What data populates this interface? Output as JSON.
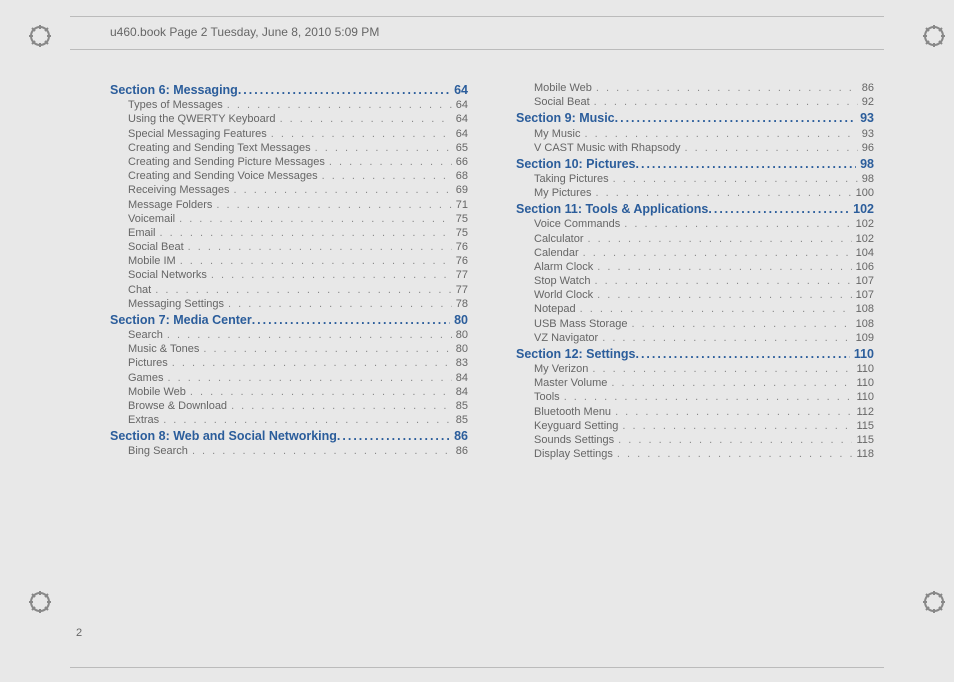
{
  "header_text": "u460.book  Page 2  Tuesday, June 8, 2010  5:09 PM",
  "page_number": "2",
  "columns": [
    [
      {
        "type": "section",
        "label": "Section 6:   Messaging",
        "page": "64"
      },
      {
        "type": "entry",
        "label": "Types of Messages",
        "page": "64"
      },
      {
        "type": "entry",
        "label": "Using the QWERTY Keyboard",
        "page": "64"
      },
      {
        "type": "entry",
        "label": "Special Messaging Features",
        "page": "64"
      },
      {
        "type": "entry",
        "label": "Creating and Sending Text Messages",
        "page": "65"
      },
      {
        "type": "entry",
        "label": "Creating and Sending Picture Messages",
        "page": "66"
      },
      {
        "type": "entry",
        "label": "Creating and Sending Voice Messages",
        "page": "68"
      },
      {
        "type": "entry",
        "label": "Receiving Messages",
        "page": "69"
      },
      {
        "type": "entry",
        "label": "Message Folders",
        "page": "71"
      },
      {
        "type": "entry",
        "label": "Voicemail",
        "page": "75"
      },
      {
        "type": "entry",
        "label": "Email",
        "page": "75"
      },
      {
        "type": "entry",
        "label": "Social Beat",
        "page": "76"
      },
      {
        "type": "entry",
        "label": "Mobile IM",
        "page": "76"
      },
      {
        "type": "entry",
        "label": "Social Networks",
        "page": "77"
      },
      {
        "type": "entry",
        "label": "Chat",
        "page": "77"
      },
      {
        "type": "entry",
        "label": "Messaging Settings",
        "page": "78"
      },
      {
        "type": "section",
        "label": "Section 7:  Media Center",
        "page": "80"
      },
      {
        "type": "entry",
        "label": "Search",
        "page": "80"
      },
      {
        "type": "entry",
        "label": "Music & Tones",
        "page": "80"
      },
      {
        "type": "entry",
        "label": "Pictures",
        "page": "83"
      },
      {
        "type": "entry",
        "label": "Games",
        "page": "84"
      },
      {
        "type": "entry",
        "label": "Mobile Web",
        "page": "84"
      },
      {
        "type": "entry",
        "label": "Browse & Download",
        "page": "85"
      },
      {
        "type": "entry",
        "label": "Extras",
        "page": "85"
      },
      {
        "type": "section",
        "label": "Section 8:  Web and Social Networking",
        "page": "86"
      },
      {
        "type": "entry",
        "label": "Bing Search",
        "page": "86"
      }
    ],
    [
      {
        "type": "entry",
        "label": "Mobile Web",
        "page": "86"
      },
      {
        "type": "entry",
        "label": "Social Beat",
        "page": "92"
      },
      {
        "type": "section",
        "label": "Section 9:  Music",
        "page": "93"
      },
      {
        "type": "entry",
        "label": "My Music",
        "page": "93"
      },
      {
        "type": "entry",
        "label": "V CAST Music with Rhapsody",
        "page": "96"
      },
      {
        "type": "section",
        "label": "Section 10:  Pictures",
        "page": "98"
      },
      {
        "type": "entry",
        "label": "Taking Pictures",
        "page": "98"
      },
      {
        "type": "entry",
        "label": "My Pictures",
        "page": "100"
      },
      {
        "type": "section",
        "label": "Section 11:  Tools & Applications",
        "page": "102"
      },
      {
        "type": "entry",
        "label": "Voice Commands",
        "page": "102"
      },
      {
        "type": "entry",
        "label": "Calculator",
        "page": "102"
      },
      {
        "type": "entry",
        "label": "Calendar",
        "page": "104"
      },
      {
        "type": "entry",
        "label": "Alarm Clock",
        "page": "106"
      },
      {
        "type": "entry",
        "label": "Stop Watch",
        "page": "107"
      },
      {
        "type": "entry",
        "label": "World Clock",
        "page": "107"
      },
      {
        "type": "entry",
        "label": "Notepad",
        "page": "108"
      },
      {
        "type": "entry",
        "label": "USB Mass Storage",
        "page": "108"
      },
      {
        "type": "entry",
        "label": "VZ Navigator",
        "page": "109"
      },
      {
        "type": "section",
        "label": "Section 12:  Settings",
        "page": "110"
      },
      {
        "type": "entry",
        "label": "My Verizon",
        "page": "110"
      },
      {
        "type": "entry",
        "label": "Master Volume",
        "page": "110"
      },
      {
        "type": "entry",
        "label": "Tools",
        "page": "110"
      },
      {
        "type": "entry",
        "label": "Bluetooth Menu",
        "page": "112"
      },
      {
        "type": "entry",
        "label": "Keyguard Setting",
        "page": "115"
      },
      {
        "type": "entry",
        "label": "Sounds Settings",
        "page": "115"
      },
      {
        "type": "entry",
        "label": "Display Settings",
        "page": "118"
      }
    ]
  ]
}
